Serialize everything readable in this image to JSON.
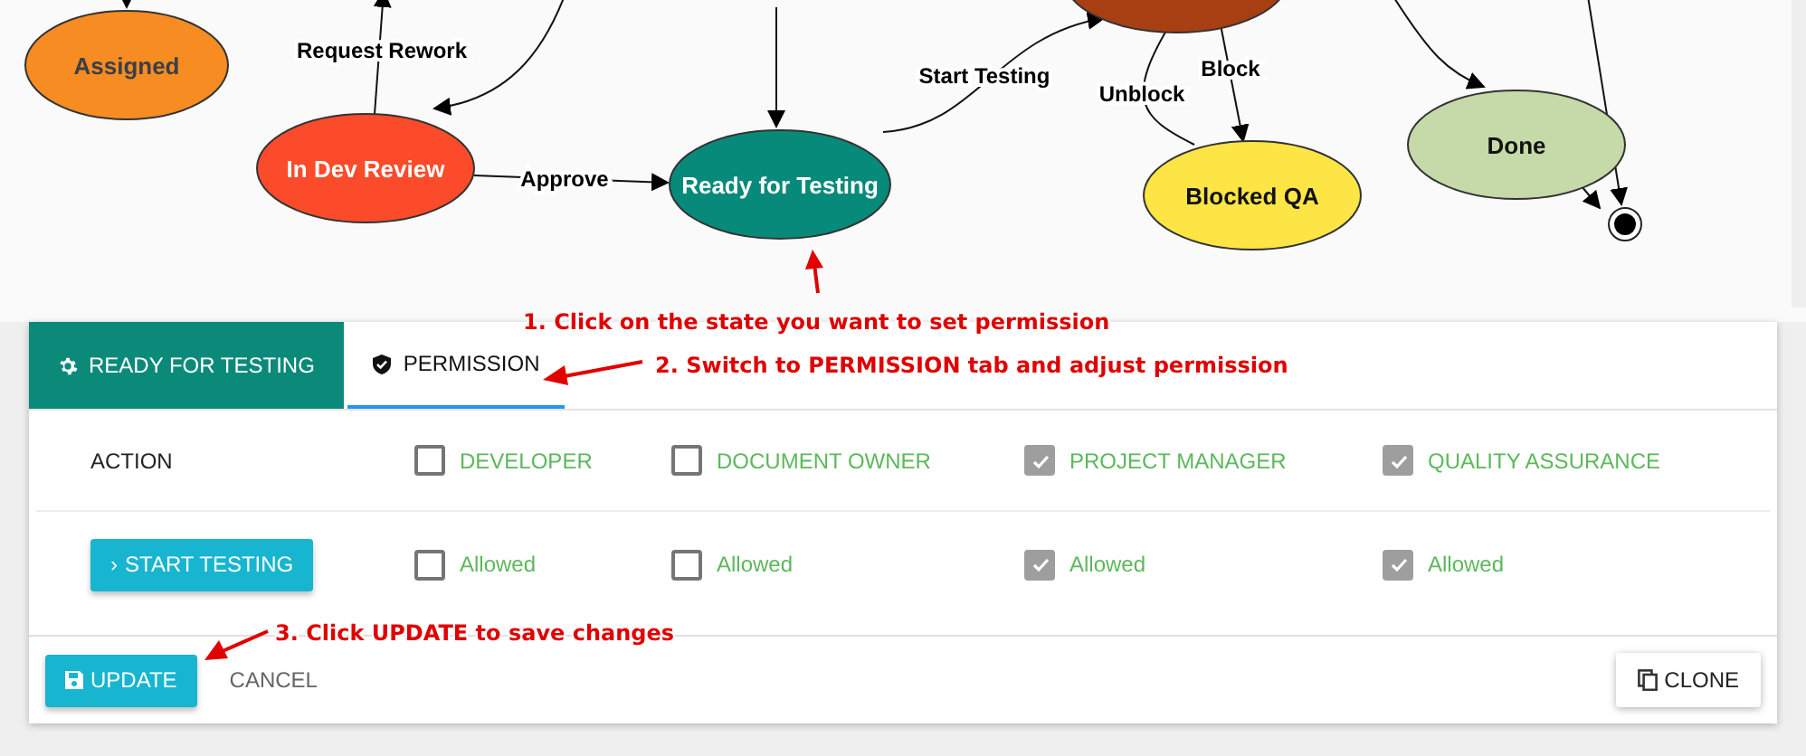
{
  "diagram": {
    "states": [
      {
        "label": "Assigned",
        "color": "#f78c22",
        "kind": "state"
      },
      {
        "label": "In Dev Review",
        "color": "#fb4b2a",
        "kind": "state"
      },
      {
        "label": "Ready for Testing",
        "color": "#078a79",
        "kind": "state"
      },
      {
        "color": "#a83f12",
        "kind": "state"
      },
      {
        "label": "Blocked QA",
        "color": "#fde546",
        "kind": "state"
      },
      {
        "label": "Done",
        "color": "#c6d9a8",
        "kind": "state"
      },
      {
        "kind": "end"
      }
    ],
    "transitions": [
      {
        "kind": "plain"
      },
      {
        "kind": "labeled",
        "label": "Request Rework"
      },
      {
        "kind": "plain"
      },
      {
        "kind": "plain"
      },
      {
        "kind": "labeled",
        "label": "Approve"
      },
      {
        "kind": "labeled",
        "label": "Start Testing"
      },
      {
        "kind": "labeled",
        "label": "Unblock"
      },
      {
        "kind": "labeled",
        "label": "Block"
      },
      {
        "kind": "plain"
      },
      {
        "kind": "plain"
      },
      {
        "kind": "plain"
      }
    ]
  },
  "panel": {
    "title": "READY FOR TESTING",
    "tabs": [
      {
        "label": "PERMISSION",
        "selected": true
      }
    ],
    "table": {
      "header": "ACTION",
      "roles": [
        {
          "label": "DEVELOPER",
          "checked": false
        },
        {
          "label": "DOCUMENT OWNER",
          "checked": false
        },
        {
          "label": "PROJECT MANAGER",
          "checked": true
        },
        {
          "label": "QUALITY ASSURANCE",
          "checked": true
        }
      ],
      "rows": [
        {
          "icon": "›",
          "action": "START TESTING",
          "cells": [
            {
              "label": "Allowed",
              "checked": false
            },
            {
              "label": "Allowed",
              "checked": false
            },
            {
              "label": "Allowed",
              "checked": true
            },
            {
              "label": "Allowed",
              "checked": true
            }
          ]
        }
      ]
    },
    "buttons": {
      "update": "UPDATE",
      "cancel": "CANCEL",
      "clone": "CLONE"
    }
  },
  "annotations": [
    {
      "text": "1. Click on the state you want to set permission"
    },
    {
      "text": "2. Switch to PERMISSION tab and adjust permission"
    },
    {
      "text": "3. Click UPDATE to save changes"
    }
  ]
}
